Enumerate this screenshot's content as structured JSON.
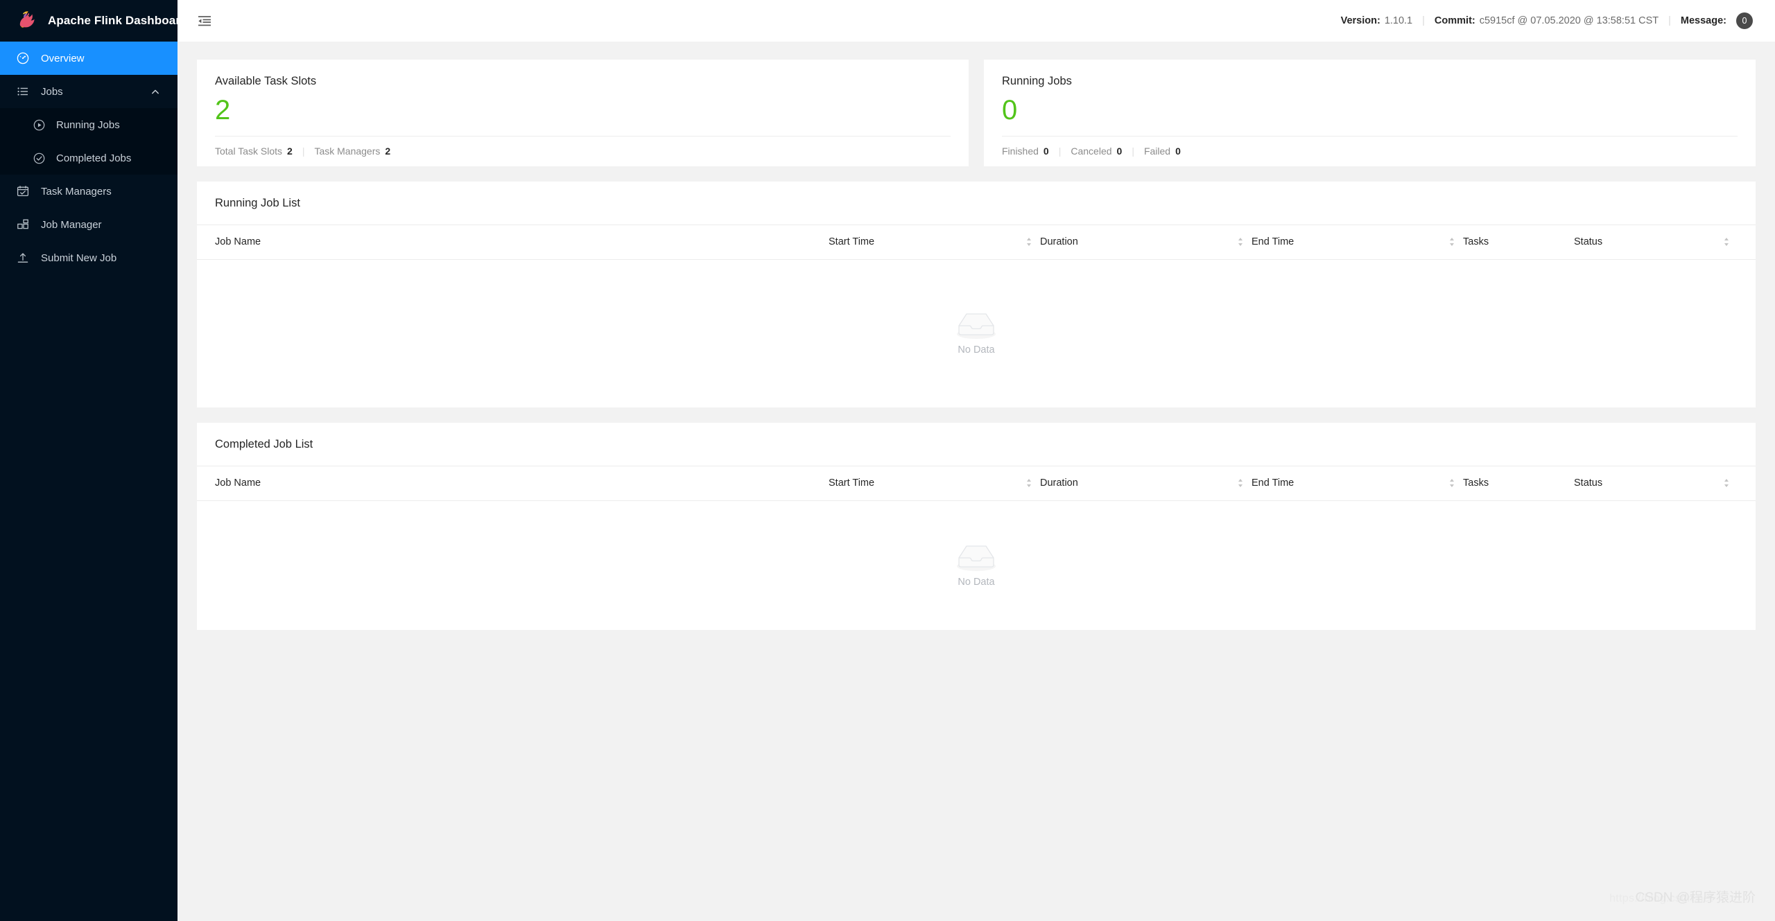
{
  "brand": {
    "title": "Apache Flink Dashboard",
    "logo_icon": "flink-squirrel-logo"
  },
  "sidebar": {
    "items": [
      {
        "label": "Overview",
        "icon": "dashboard-icon",
        "active": true
      },
      {
        "label": "Jobs",
        "icon": "list-icon",
        "expanded": true,
        "caret_icon": "chevron-up-icon"
      },
      {
        "label": "Task Managers",
        "icon": "task-managers-icon",
        "active": false
      },
      {
        "label": "Job Manager",
        "icon": "job-manager-icon",
        "active": false
      },
      {
        "label": "Submit New Job",
        "icon": "upload-icon",
        "active": false
      }
    ],
    "jobs_submenu": [
      {
        "label": "Running Jobs",
        "icon": "play-circle-icon"
      },
      {
        "label": "Completed Jobs",
        "icon": "check-circle-icon"
      }
    ]
  },
  "topbar": {
    "fold_icon": "menu-fold-icon",
    "version_label": "Version:",
    "version_value": "1.10.1",
    "commit_label": "Commit:",
    "commit_value": "c5915cf @ 07.05.2020 @ 13:58:51 CST",
    "message_label": "Message:",
    "message_count": "0",
    "separator": "|"
  },
  "stats": {
    "task_slots": {
      "title": "Available Task Slots",
      "value": "2",
      "value_color": "#52c41a",
      "footer": [
        {
          "key": "Total Task Slots",
          "value": "2"
        },
        {
          "key": "Task Managers",
          "value": "2"
        }
      ]
    },
    "running_jobs": {
      "title": "Running Jobs",
      "value": "0",
      "value_color": "#52c41a",
      "footer": [
        {
          "key": "Finished",
          "value": "0"
        },
        {
          "key": "Canceled",
          "value": "0"
        },
        {
          "key": "Failed",
          "value": "0"
        }
      ]
    }
  },
  "running_job_list": {
    "title": "Running Job List",
    "columns": [
      {
        "label": "Job Name",
        "sortable": false
      },
      {
        "label": "Start Time",
        "sortable": true
      },
      {
        "label": "Duration",
        "sortable": true
      },
      {
        "label": "End Time",
        "sortable": true
      },
      {
        "label": "Tasks",
        "sortable": true
      },
      {
        "label": "Status",
        "sortable": true
      }
    ],
    "rows": [],
    "empty_text": "No Data",
    "empty_icon": "empty-box-icon"
  },
  "completed_job_list": {
    "title": "Completed Job List",
    "columns": [
      {
        "label": "Job Name",
        "sortable": false
      },
      {
        "label": "Start Time",
        "sortable": true
      },
      {
        "label": "Duration",
        "sortable": true
      },
      {
        "label": "End Time",
        "sortable": true
      },
      {
        "label": "Tasks",
        "sortable": true
      },
      {
        "label": "Status",
        "sortable": true
      }
    ],
    "rows": [],
    "empty_text": "No Data",
    "empty_icon": "empty-box-icon"
  },
  "watermark": {
    "url": "https://blog.csdn.net",
    "tag": "CSDN @程序猿进阶"
  },
  "colors": {
    "sidebar_bg": "#02111f",
    "submenu_bg": "#000c17",
    "accent": "#1890ff",
    "success": "#52c41a",
    "page_bg": "#f2f2f2"
  }
}
